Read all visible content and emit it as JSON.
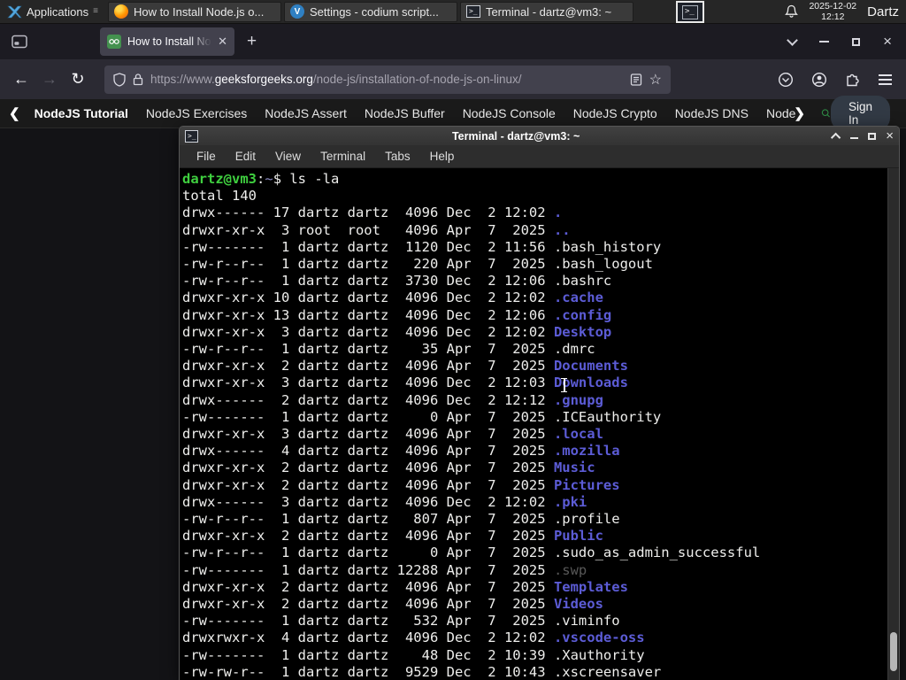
{
  "panel": {
    "applications_label": "Applications",
    "taskbar": [
      {
        "icon": "firefox",
        "title": "How to Install Node.js o..."
      },
      {
        "icon": "codium",
        "title": "Settings - codium script..."
      },
      {
        "icon": "terminal",
        "title": "Terminal - dartz@vm3: ~"
      }
    ],
    "clock_date": "2025-12-02",
    "clock_time": "12:12",
    "user": "Dartz"
  },
  "browser": {
    "tab_title": "How to Install Node.js on",
    "url_scheme": "https://www.",
    "url_domain": "geeksforgeeks.org",
    "url_path": "/node-js/installation-of-node-js-on-linux/"
  },
  "site_nav": {
    "items": [
      "NodeJS Tutorial",
      "NodeJS Exercises",
      "NodeJS Assert",
      "NodeJS Buffer",
      "NodeJS Console",
      "NodeJS Crypto",
      "NodeJS DNS",
      "Node"
    ],
    "sign_in": "Sign In"
  },
  "terminal": {
    "window_title": "Terminal - dartz@vm3: ~",
    "menu": [
      "File",
      "Edit",
      "View",
      "Terminal",
      "Tabs",
      "Help"
    ],
    "prompt": {
      "userhost": "dartz@vm3",
      "colon": ":",
      "cwd": "~",
      "rest": "$ ls -la"
    },
    "total": "total 140",
    "files": [
      {
        "perm": "drwx------",
        "links": 17,
        "owner": "dartz",
        "group": "dartz",
        "size": 4096,
        "month": "Dec",
        "day": 2,
        "ty": "12:02",
        "name": ".",
        "cls": "d"
      },
      {
        "perm": "drwxr-xr-x",
        "links": 3,
        "owner": "root",
        "group": "root",
        "size": 4096,
        "month": "Apr",
        "day": 7,
        "ty": "2025",
        "name": "..",
        "cls": "d"
      },
      {
        "perm": "-rw-------",
        "links": 1,
        "owner": "dartz",
        "group": "dartz",
        "size": 1120,
        "month": "Dec",
        "day": 2,
        "ty": "11:56",
        "name": ".bash_history",
        "cls": "f"
      },
      {
        "perm": "-rw-r--r--",
        "links": 1,
        "owner": "dartz",
        "group": "dartz",
        "size": 220,
        "month": "Apr",
        "day": 7,
        "ty": "2025",
        "name": ".bash_logout",
        "cls": "f"
      },
      {
        "perm": "-rw-r--r--",
        "links": 1,
        "owner": "dartz",
        "group": "dartz",
        "size": 3730,
        "month": "Dec",
        "day": 2,
        "ty": "12:06",
        "name": ".bashrc",
        "cls": "f"
      },
      {
        "perm": "drwxr-xr-x",
        "links": 10,
        "owner": "dartz",
        "group": "dartz",
        "size": 4096,
        "month": "Dec",
        "day": 2,
        "ty": "12:02",
        "name": ".cache",
        "cls": "d"
      },
      {
        "perm": "drwxr-xr-x",
        "links": 13,
        "owner": "dartz",
        "group": "dartz",
        "size": 4096,
        "month": "Dec",
        "day": 2,
        "ty": "12:06",
        "name": ".config",
        "cls": "d"
      },
      {
        "perm": "drwxr-xr-x",
        "links": 3,
        "owner": "dartz",
        "group": "dartz",
        "size": 4096,
        "month": "Dec",
        "day": 2,
        "ty": "12:02",
        "name": "Desktop",
        "cls": "d"
      },
      {
        "perm": "-rw-r--r--",
        "links": 1,
        "owner": "dartz",
        "group": "dartz",
        "size": 35,
        "month": "Apr",
        "day": 7,
        "ty": "2025",
        "name": ".dmrc",
        "cls": "f"
      },
      {
        "perm": "drwxr-xr-x",
        "links": 2,
        "owner": "dartz",
        "group": "dartz",
        "size": 4096,
        "month": "Apr",
        "day": 7,
        "ty": "2025",
        "name": "Documents",
        "cls": "d"
      },
      {
        "perm": "drwxr-xr-x",
        "links": 3,
        "owner": "dartz",
        "group": "dartz",
        "size": 4096,
        "month": "Dec",
        "day": 2,
        "ty": "12:03",
        "name": "Downloads",
        "cls": "d"
      },
      {
        "perm": "drwx------",
        "links": 2,
        "owner": "dartz",
        "group": "dartz",
        "size": 4096,
        "month": "Dec",
        "day": 2,
        "ty": "12:12",
        "name": ".gnupg",
        "cls": "d"
      },
      {
        "perm": "-rw-------",
        "links": 1,
        "owner": "dartz",
        "group": "dartz",
        "size": 0,
        "month": "Apr",
        "day": 7,
        "ty": "2025",
        "name": ".ICEauthority",
        "cls": "f"
      },
      {
        "perm": "drwxr-xr-x",
        "links": 3,
        "owner": "dartz",
        "group": "dartz",
        "size": 4096,
        "month": "Apr",
        "day": 7,
        "ty": "2025",
        "name": ".local",
        "cls": "d"
      },
      {
        "perm": "drwx------",
        "links": 4,
        "owner": "dartz",
        "group": "dartz",
        "size": 4096,
        "month": "Apr",
        "day": 7,
        "ty": "2025",
        "name": ".mozilla",
        "cls": "d"
      },
      {
        "perm": "drwxr-xr-x",
        "links": 2,
        "owner": "dartz",
        "group": "dartz",
        "size": 4096,
        "month": "Apr",
        "day": 7,
        "ty": "2025",
        "name": "Music",
        "cls": "d"
      },
      {
        "perm": "drwxr-xr-x",
        "links": 2,
        "owner": "dartz",
        "group": "dartz",
        "size": 4096,
        "month": "Apr",
        "day": 7,
        "ty": "2025",
        "name": "Pictures",
        "cls": "d"
      },
      {
        "perm": "drwx------",
        "links": 3,
        "owner": "dartz",
        "group": "dartz",
        "size": 4096,
        "month": "Dec",
        "day": 2,
        "ty": "12:02",
        "name": ".pki",
        "cls": "d"
      },
      {
        "perm": "-rw-r--r--",
        "links": 1,
        "owner": "dartz",
        "group": "dartz",
        "size": 807,
        "month": "Apr",
        "day": 7,
        "ty": "2025",
        "name": ".profile",
        "cls": "f"
      },
      {
        "perm": "drwxr-xr-x",
        "links": 2,
        "owner": "dartz",
        "group": "dartz",
        "size": 4096,
        "month": "Apr",
        "day": 7,
        "ty": "2025",
        "name": "Public",
        "cls": "d"
      },
      {
        "perm": "-rw-r--r--",
        "links": 1,
        "owner": "dartz",
        "group": "dartz",
        "size": 0,
        "month": "Apr",
        "day": 7,
        "ty": "2025",
        "name": ".sudo_as_admin_successful",
        "cls": "f"
      },
      {
        "perm": "-rw-------",
        "links": 1,
        "owner": "dartz",
        "group": "dartz",
        "size": 12288,
        "month": "Apr",
        "day": 7,
        "ty": "2025",
        "name": ".swp",
        "cls": "x"
      },
      {
        "perm": "drwxr-xr-x",
        "links": 2,
        "owner": "dartz",
        "group": "dartz",
        "size": 4096,
        "month": "Apr",
        "day": 7,
        "ty": "2025",
        "name": "Templates",
        "cls": "d"
      },
      {
        "perm": "drwxr-xr-x",
        "links": 2,
        "owner": "dartz",
        "group": "dartz",
        "size": 4096,
        "month": "Apr",
        "day": 7,
        "ty": "2025",
        "name": "Videos",
        "cls": "d"
      },
      {
        "perm": "-rw-------",
        "links": 1,
        "owner": "dartz",
        "group": "dartz",
        "size": 532,
        "month": "Apr",
        "day": 7,
        "ty": "2025",
        "name": ".viminfo",
        "cls": "f"
      },
      {
        "perm": "drwxrwxr-x",
        "links": 4,
        "owner": "dartz",
        "group": "dartz",
        "size": 4096,
        "month": "Dec",
        "day": 2,
        "ty": "12:02",
        "name": ".vscode-oss",
        "cls": "d"
      },
      {
        "perm": "-rw-------",
        "links": 1,
        "owner": "dartz",
        "group": "dartz",
        "size": 48,
        "month": "Dec",
        "day": 2,
        "ty": "10:39",
        "name": ".Xauthority",
        "cls": "f"
      },
      {
        "perm": "-rw-rw-r--",
        "links": 1,
        "owner": "dartz",
        "group": "dartz",
        "size": 9529,
        "month": "Dec",
        "day": 2,
        "ty": "10:43",
        "name": ".xscreensaver",
        "cls": "f"
      }
    ]
  },
  "colors": {
    "dir_blue": "#5c5cd6",
    "prompt_green": "#3fcf3f",
    "gfg_green": "#2f8d46",
    "accent_tab": "#42414d"
  }
}
